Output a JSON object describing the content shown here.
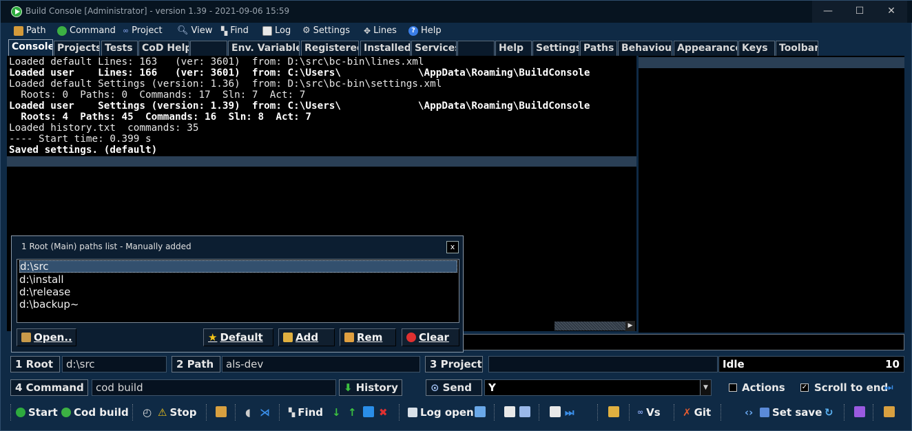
{
  "window": {
    "title": "Build Console [Administrator] - version 1.39 - 2021-09-06 15:59",
    "min": "—",
    "max": "☐",
    "close": "✕"
  },
  "menu": [
    {
      "label": "Path",
      "icon": "path-icon",
      "color": "#d49a3a"
    },
    {
      "label": "Command",
      "icon": "command-icon",
      "color": "#3cb043"
    },
    {
      "label": "Project",
      "icon": "project-icon",
      "color": "#6a8fe0"
    },
    {
      "label": "View",
      "icon": "view-icon",
      "color": "#9ab8e8"
    },
    {
      "label": "Find",
      "icon": "find-icon",
      "color": "#d8d8d8"
    },
    {
      "label": "Log",
      "icon": "log-icon",
      "color": "#e8e8e8"
    },
    {
      "label": "Settings",
      "icon": "settings-icon",
      "color": "#c8c8c8"
    },
    {
      "label": "Lines",
      "icon": "lines-icon",
      "color": "#c8c8c8"
    },
    {
      "label": "Help",
      "icon": "help-icon",
      "color": "#3a7ee8"
    }
  ],
  "tabs": [
    "Console",
    "Projects",
    "Tests",
    "CoD Help",
    "",
    "Env. Variables",
    "Registered",
    "Installed",
    "Services",
    "",
    "Help",
    "Settings",
    "Paths",
    "Behaviour",
    "Appearance",
    "Keys",
    "Toolbar"
  ],
  "console": {
    "lines": [
      "Loaded default Lines: 163   (ver: 3601)  from: D:\\src\\bc-bin\\lines.xml",
      "Loaded user    Lines: 166   (ver: 3601)  from: C:\\Users\\             \\AppData\\Roaming\\BuildConsole",
      "Loaded default Settings (version: 1.36)  from: D:\\src\\bc-bin\\settings.xml",
      "  Roots: 0  Paths: 0  Commands: 17  Sln: 7  Act: 7",
      "Loaded user    Settings (version: 1.39)  from: C:\\Users\\             \\AppData\\Roaming\\BuildConsole",
      "  Roots: 4  Paths: 45  Commands: 16  Sln: 8  Act: 7",
      "Loaded history.txt  commands: 35",
      "---- Start time: 0.399 s",
      "Saved settings. (default)"
    ]
  },
  "dialog": {
    "title": "1 Root (Main) paths list - Manually added",
    "close": "x",
    "items": [
      "d:\\src",
      "d:\\install",
      "d:\\release",
      "d:\\backup~"
    ],
    "buttons": {
      "open": "Open..",
      "default": "Default",
      "add": "Add",
      "rem": "Rem",
      "clear": "Clear"
    }
  },
  "rows": {
    "root_label": "1 Root",
    "root_value": "d:\\src",
    "path_label": "2 Path",
    "path_value": "als-dev",
    "project_label": "3 Project",
    "project_value": "",
    "status": "Idle",
    "count": "10",
    "command_label": "4 Command",
    "command_value": "cod build",
    "history": "History",
    "send": "Send",
    "send_value": "Y",
    "actions": "Actions",
    "scroll_to_end": "Scroll to end"
  },
  "toolbar": {
    "start": "Start",
    "cod_build": "Cod build",
    "stop": "Stop",
    "find": "Find",
    "log_open": "Log open",
    "vs": "Vs",
    "git": "Git",
    "set_save": "Set save"
  }
}
